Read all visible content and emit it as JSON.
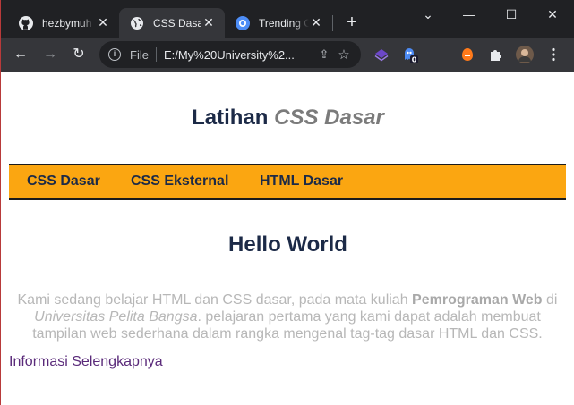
{
  "browser": {
    "tabs": [
      {
        "title": "hezbymuh",
        "icon": "github-icon",
        "active": false
      },
      {
        "title": "CSS Dasar",
        "icon": "globe-icon",
        "active": true
      },
      {
        "title": "Trending C",
        "icon": "chrome-site-icon",
        "active": false
      }
    ],
    "new_tab": "+",
    "window": {
      "minimize": "—",
      "maximize": "☐",
      "close": "✕",
      "tab_search": "⌄"
    },
    "nav": {
      "back": "←",
      "forward": "→",
      "reload": "↻"
    },
    "address": {
      "scheme": "File",
      "url": "E:/My%20University%2...",
      "share": "⇪",
      "star": "☆"
    },
    "extensions": [
      {
        "name": "layers-extension-icon",
        "color": "#6c47c9"
      },
      {
        "name": "ghost-extension-icon",
        "color": "#4c8bf5",
        "badge": "0"
      },
      {
        "name": "honey-extension-icon",
        "color": "#ff7a1a"
      },
      {
        "name": "puzzle-extensions-icon",
        "color": "#e8eaed"
      },
      {
        "name": "profile-avatar",
        "color": "#8a6e5a"
      },
      {
        "name": "menu-kebab-icon",
        "color": "#e8eaed"
      }
    ]
  },
  "page": {
    "title_main": "Latihan",
    "title_em": "CSS Dasar",
    "menu": [
      "CSS Dasar",
      "CSS Eksternal",
      "HTML Dasar"
    ],
    "heading": "Hello World",
    "para": {
      "part1": "Kami sedang belajar HTML dan CSS dasar, pada mata kuliah ",
      "bold": "Pemrograman Web",
      "part2": " di ",
      "italic": "Universitas Pelita Bangsa",
      "part3": ". pelajaran pertama yang kami dapat adalah membuat tampilan web sederhana dalam rangka mengenal tag-tag dasar HTML dan CSS."
    },
    "link": "Informasi Selengkapnya"
  },
  "colors": {
    "nav_bg": "#fba611",
    "title": "#1c2a47",
    "link": "#5a2a7a"
  }
}
